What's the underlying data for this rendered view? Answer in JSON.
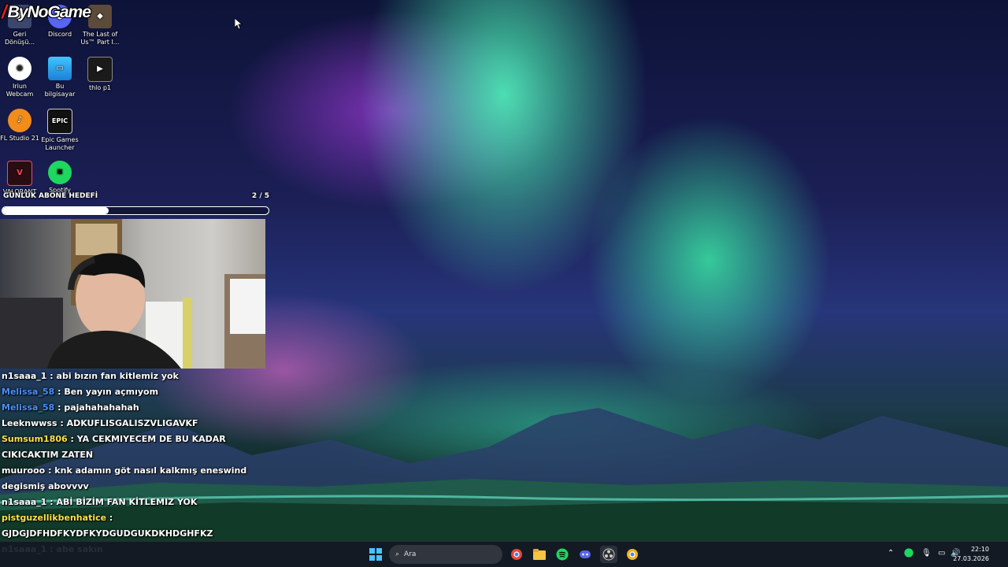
{
  "overlay": {
    "logo": "ByNoGame",
    "goal_title": "GÜNLÜK ABONE HEDEFİ",
    "goal_count": "2 / 5",
    "goal_progress": 0.4
  },
  "desktop": {
    "icons": [
      {
        "label": "Geri Dönüşü...",
        "icon": "recycle-bin-icon"
      },
      {
        "label": "Discord",
        "icon": "discord-icon"
      },
      {
        "label": "The Last of Us™ Part I...",
        "icon": "game-icon"
      },
      {
        "label": "Iriun Webcam",
        "icon": "webcam-icon"
      },
      {
        "label": "Bu bilgisayar",
        "icon": "monitor-icon"
      },
      {
        "label": "thlo p1",
        "icon": "video-file-icon"
      },
      {
        "label": "FL Studio 21",
        "icon": "fl-studio-icon"
      },
      {
        "label": "Epic Games Launcher",
        "icon": "epic-games-icon"
      },
      {
        "label": "VALORANT",
        "icon": "valorant-icon"
      },
      {
        "label": "Spotify",
        "icon": "spotify-icon"
      }
    ]
  },
  "chat": [
    {
      "user": "n1saaa_1",
      "text": "abi bızın fan kitlemiz yok",
      "color": "white"
    },
    {
      "user": "Melissa_58",
      "text": "Ben yayın açmıyom",
      "color": "blue"
    },
    {
      "user": "Melissa_58",
      "text": "pajahahahahah",
      "color": "blue"
    },
    {
      "user": "Leeknwwss",
      "text": "ADKUFLISGALISZVLIGAVKF",
      "color": "white"
    },
    {
      "user": "Sumsum1806",
      "text": "YA CEKMIYECEM DE BU KADAR",
      "color": "yellow"
    },
    {
      "user": "",
      "text": "CIKICAKTIM ZATEN",
      "color": "white"
    },
    {
      "user": "muurooo",
      "text": "knk adamın göt nasıl kalkmış eneswind",
      "color": "white"
    },
    {
      "user": "",
      "text": "degismiş abovvvv",
      "color": "white"
    },
    {
      "user": "n1saaa_1",
      "text": "ABİ BİZİM FAN KİTLEMIZ YOK",
      "color": "white"
    },
    {
      "user": "pistguzellikbenhatice",
      "text": "",
      "color": "yellow"
    },
    {
      "user": "",
      "text": "GJDGJDFHDFKYDFKYDGUDGUKDKHDGHFKZ",
      "color": "white"
    },
    {
      "user": "n1saaa_1",
      "text": "abe sakın",
      "color": "white"
    }
  ],
  "colors": {
    "taskbar": "#161a26",
    "chat_blue": "#4a8fff",
    "chat_yellow": "#ffe24a",
    "spotify": "#1ed760"
  },
  "taskbar": {
    "search_placeholder": "Ara",
    "start_icon": "windows-start-icon",
    "apps": [
      "chrome-icon",
      "file-explorer-icon",
      "spotify-icon",
      "discord-icon",
      "obs-icon",
      "chrome-canary-icon"
    ],
    "tray": [
      "chevron-up-icon",
      "spotify-icon",
      "microphone-icon",
      "display-icon",
      "speaker-icon"
    ],
    "time": "22:10",
    "date": "27.03.2026"
  }
}
